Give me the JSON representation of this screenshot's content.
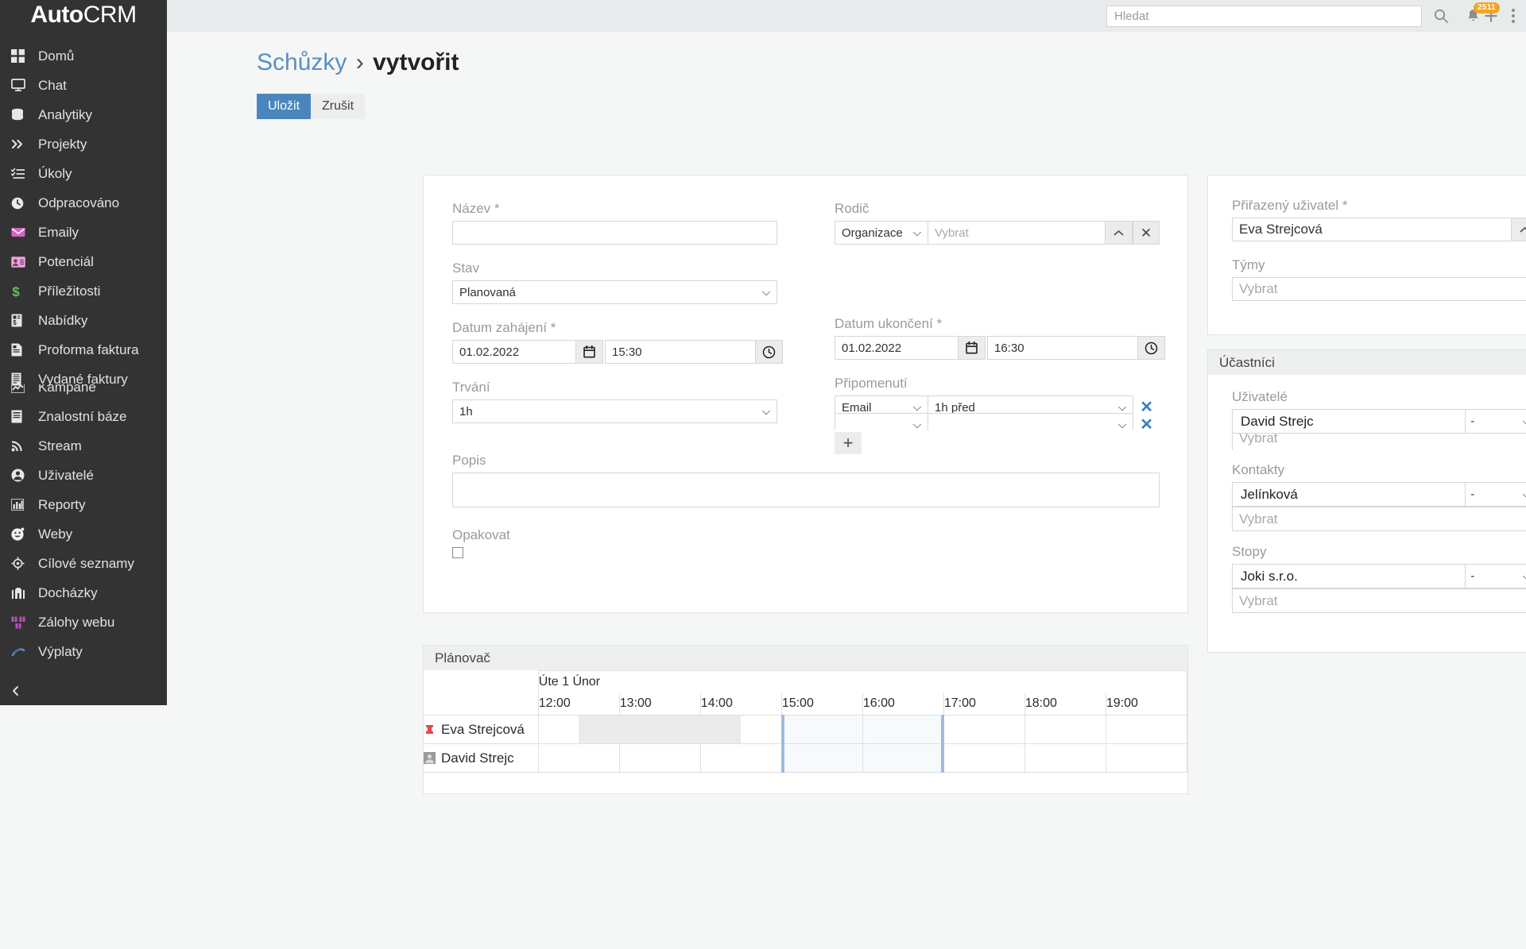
{
  "brand": {
    "name_bold": "Auto",
    "name_light": "CRM",
    "full": "AutoCRM"
  },
  "topbar": {
    "search_placeholder": "Hledat",
    "search_value": "",
    "notification_count": "2511"
  },
  "sidebar": {
    "collapse_label": "",
    "items": [
      {
        "label": "Domů",
        "icon": "grid-icon"
      },
      {
        "label": "Chat",
        "icon": "monitor-icon"
      },
      {
        "label": "Analytiky",
        "icon": "database-icon"
      },
      {
        "label": "Projekty",
        "icon": "chevrons-right-icon"
      },
      {
        "label": "Úkoly",
        "icon": "checklist-icon"
      },
      {
        "label": "Odpracováno",
        "icon": "clock-icon"
      },
      {
        "label": "Emaily",
        "icon": "envelope-icon"
      },
      {
        "label": "Potenciál",
        "icon": "contact-card-icon"
      },
      {
        "label": "Příležitosti",
        "icon": "dollar-icon"
      },
      {
        "label": "Nabídky",
        "icon": "quote-doc-icon"
      },
      {
        "label": "Proforma faktura",
        "icon": "proforma-doc-icon"
      },
      {
        "label": "Vydané faktury",
        "icon": "invoice-icon"
      },
      {
        "label": "Kampaně",
        "icon": "campaign-chart-icon",
        "clipped": true
      },
      {
        "label": "Znalostní báze",
        "icon": "book-icon"
      },
      {
        "label": "Stream",
        "icon": "rss-icon"
      },
      {
        "label": "Uživatelé",
        "icon": "user-circle-icon"
      },
      {
        "label": "Reporty",
        "icon": "bar-chart-icon"
      },
      {
        "label": "Weby",
        "icon": "smiley-icon"
      },
      {
        "label": "Cílové seznamy",
        "icon": "crosshair-icon"
      },
      {
        "label": "Docházky",
        "icon": "building-icon"
      },
      {
        "label": "Zálohy webu",
        "icon": "boxes-icon"
      },
      {
        "label": "Výplaty",
        "icon": "money-icon"
      }
    ]
  },
  "breadcrumb": {
    "parent": "Schůzky",
    "separator": "›",
    "current": "vytvořit"
  },
  "actions": {
    "save": "Uložit",
    "cancel": "Zrušit"
  },
  "form": {
    "name": {
      "label": "Název *",
      "value": "",
      "placeholder": ""
    },
    "parent": {
      "label": "Rodič",
      "type_value": "Organizace",
      "type_options": [
        "Organizace"
      ],
      "record_placeholder": "Vybrat",
      "record_value": ""
    },
    "status": {
      "label": "Stav",
      "value": "Planovaná",
      "options": [
        "Planovaná"
      ]
    },
    "date_start": {
      "label": "Datum zahájení *",
      "date": "01.02.2022",
      "time": "15:30"
    },
    "date_end": {
      "label": "Datum ukončení *",
      "date": "01.02.2022",
      "time": "16:30"
    },
    "duration": {
      "label": "Trvání",
      "value": "1h",
      "options": [
        "1h"
      ]
    },
    "reminders": {
      "label": "Připomenutí",
      "rows": [
        {
          "type": "Email",
          "when": "1h před"
        },
        {
          "type": "",
          "when": ""
        }
      ],
      "add_label": "+"
    },
    "description": {
      "label": "Popis",
      "value": "",
      "placeholder": ""
    },
    "repeat": {
      "label": "Opakovat",
      "checked": false
    }
  },
  "side_panel": {
    "assigned_user": {
      "label": "Přiřazený uživatel *",
      "value": "Eva Strejcová"
    },
    "teams": {
      "label": "Týmy",
      "placeholder": "Vybrat",
      "value": ""
    }
  },
  "attendees": {
    "title": "Účastníci",
    "users": {
      "label": "Uživatelé",
      "rows": [
        {
          "name": "David Strejc",
          "status": "-"
        }
      ],
      "placeholder": "Vybrat"
    },
    "contacts": {
      "label": "Kontakty",
      "rows": [
        {
          "name": "Jelínková",
          "status": "-"
        }
      ],
      "placeholder": "Vybrat"
    },
    "leads": {
      "label": "Stopy",
      "rows": [
        {
          "name": "Joki s.r.o.",
          "status": "-"
        }
      ],
      "placeholder": "Vybrat"
    },
    "status_options": [
      "-"
    ]
  },
  "scheduler": {
    "title": "Plánovač",
    "day_label": "Úte 1 Únor",
    "hours": [
      "12:00",
      "13:00",
      "14:00",
      "15:00",
      "16:00",
      "17:00",
      "18:00",
      "19:00"
    ],
    "rows": [
      {
        "name": "Eva Strejcová",
        "avatar": "pin-avatar"
      },
      {
        "name": "David Strejc",
        "avatar": "photo-avatar"
      }
    ]
  },
  "colors": {
    "sidebar_bg": "#333333",
    "topbar_bg": "#e8ebeb",
    "primary": "#4a86bd",
    "link": "#5a8fc0",
    "badge": "#f0a623",
    "selection": "#9cbcdc",
    "busy": "#ebebeb"
  }
}
